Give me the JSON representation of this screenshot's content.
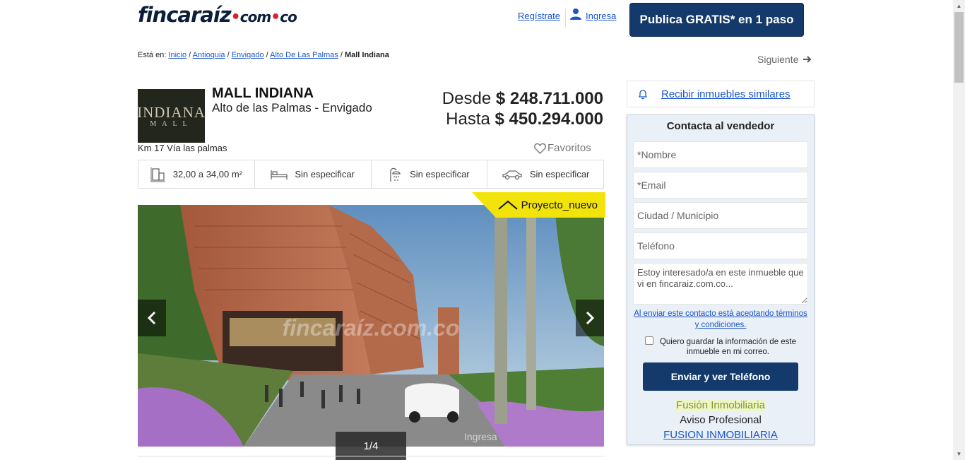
{
  "header": {
    "logo_main": "fincaraíz",
    "logo_sub": "com",
    "logo_sub2": "co",
    "register": "Regístrate",
    "login": "Ingresa",
    "publish": "Publica GRATIS* en 1 paso"
  },
  "breadcrumb": {
    "prefix": "Está en:",
    "items": [
      "Inicio",
      "Antioquia",
      "Envigado",
      "Alto De Las Palmas"
    ],
    "current": "Mall Indiana"
  },
  "next_label": "Siguiente",
  "property": {
    "logo_line1": "INDIANA",
    "logo_line2": "MALL",
    "title": "MALL INDIANA",
    "location": "Alto de las Palmas - Envigado",
    "price_from_label": "Desde",
    "price_from": "$ 248.711.000",
    "price_to_label": "Hasta",
    "price_to": "$ 450.294.000",
    "address": "Km 17 Vía las palmas",
    "favorites": "Favoritos"
  },
  "features": [
    {
      "icon": "area-icon",
      "value": "32,00 a 34,00 m²"
    },
    {
      "icon": "bed-icon",
      "value": "Sin especificar"
    },
    {
      "icon": "shower-icon",
      "value": "Sin especificar"
    },
    {
      "icon": "car-icon",
      "value": "Sin especificar"
    }
  ],
  "gallery": {
    "tag": "Proyecto_nuevo",
    "counter": "1/4",
    "watermark": "fincaraíz.com.co",
    "watermark2": "Ingresa"
  },
  "sidebar": {
    "similar": "Recibir inmuebles similares",
    "contact_title": "Contacta al vendedor",
    "name_placeholder": "*Nombre",
    "email_placeholder": "*Email",
    "city_placeholder": "Ciudad / Municipio",
    "phone_placeholder": "Teléfono",
    "message": "Estoy interesado/a en este inmueble que vi en fincaraiz.com.co...",
    "terms": "Al enviar este contacto está aceptando términos y condiciones.",
    "save_info": "Quiero guardar la información de este inmueble en mi correo.",
    "send_button": "Enviar y ver Teléfono",
    "agency_name": "Fusión Inmobiliaria",
    "agency_type": "Aviso Profesional",
    "agency_link": "FUSION INMOBILIARIA"
  },
  "colors": {
    "brand_navy": "#133a6b",
    "tag_yellow": "#f2e40b",
    "link_blue": "#1a56c9"
  }
}
